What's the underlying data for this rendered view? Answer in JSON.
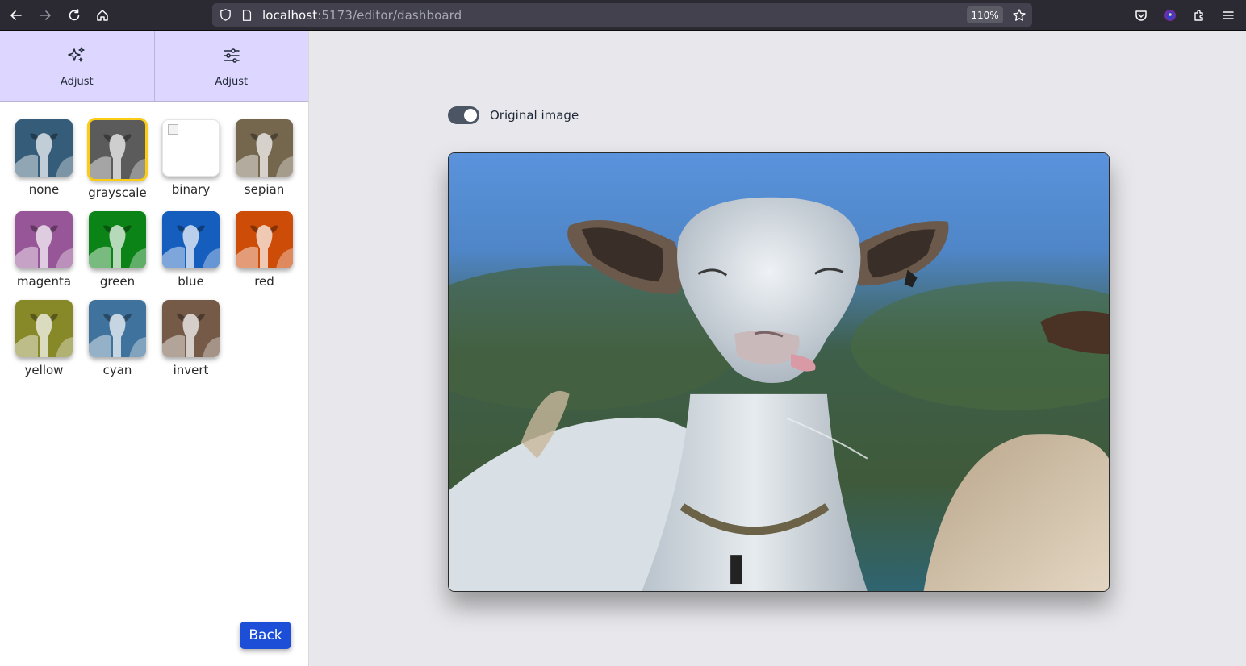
{
  "browser": {
    "url_host": "localhost",
    "url_path": ":5173/editor/dashboard",
    "zoom": "110%"
  },
  "sidebar": {
    "tabs": [
      {
        "label": "Adjust",
        "icon": "sparkles-icon"
      },
      {
        "label": "Adjust",
        "icon": "sliders-icon"
      }
    ],
    "filters": [
      {
        "label": "none",
        "tint": "#3f6e8f",
        "selected": false
      },
      {
        "label": "grayscale",
        "tint": "#6b6b6b",
        "selected": true
      },
      {
        "label": "binary",
        "tint": "#ffffff",
        "selected": false
      },
      {
        "label": "sepian",
        "tint": "#8a7a5c",
        "selected": false
      },
      {
        "label": "magenta",
        "tint": "#b266b2",
        "selected": false
      },
      {
        "label": "green",
        "tint": "#0f9a1a",
        "selected": false
      },
      {
        "label": "blue",
        "tint": "#1a6fe0",
        "selected": false
      },
      {
        "label": "red",
        "tint": "#f05a0a",
        "selected": false
      },
      {
        "label": "yellow",
        "tint": "#9fa030",
        "selected": false
      },
      {
        "label": "cyan",
        "tint": "#4a86b8",
        "selected": false
      },
      {
        "label": "invert",
        "tint": "#8a6a55",
        "selected": false
      }
    ],
    "back_label": "Back"
  },
  "main": {
    "toggle_label": "Original image",
    "toggle_on": true
  }
}
